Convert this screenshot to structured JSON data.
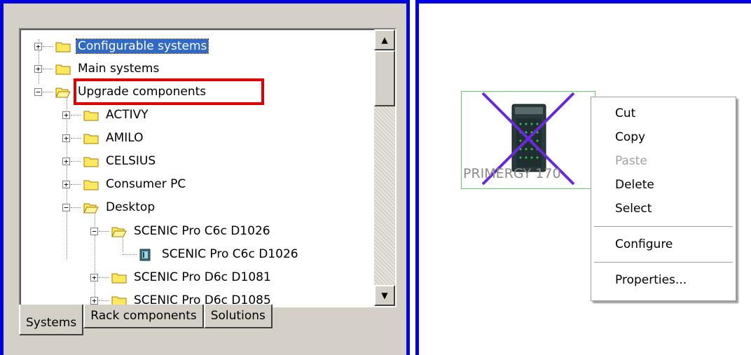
{
  "tree": {
    "items": [
      {
        "label": "Configurable systems",
        "selected": true
      },
      {
        "label": "Main systems"
      },
      {
        "label": "Upgrade components"
      },
      {
        "label": "ACTIVY"
      },
      {
        "label": "AMILO"
      },
      {
        "label": "CELSIUS"
      },
      {
        "label": "Consumer PC"
      },
      {
        "label": "Desktop"
      },
      {
        "label": "SCENIC Pro C6c D1026"
      },
      {
        "label": "SCENIC Pro C6c D1026"
      },
      {
        "label": "SCENIC Pro D6c D1081"
      },
      {
        "label": "SCENIC Pro D6c D1085"
      }
    ]
  },
  "tabs": [
    {
      "label": "Systems",
      "active": true
    },
    {
      "label": "Rack components"
    },
    {
      "label": "Solutions"
    }
  ],
  "canvas": {
    "device_label": "PRIMERGY 170"
  },
  "context_menu": {
    "items": [
      {
        "label": "Cut"
      },
      {
        "label": "Copy"
      },
      {
        "label": "Paste",
        "disabled": true
      },
      {
        "label": "Delete"
      },
      {
        "label": "Select"
      },
      {
        "label": "Configure"
      },
      {
        "label": "Properties..."
      }
    ]
  },
  "colors": {
    "panel_border": "#0000e0",
    "highlight": "#e00000",
    "selection": "#316ac5",
    "delete_cross": "#6a2ad8"
  }
}
